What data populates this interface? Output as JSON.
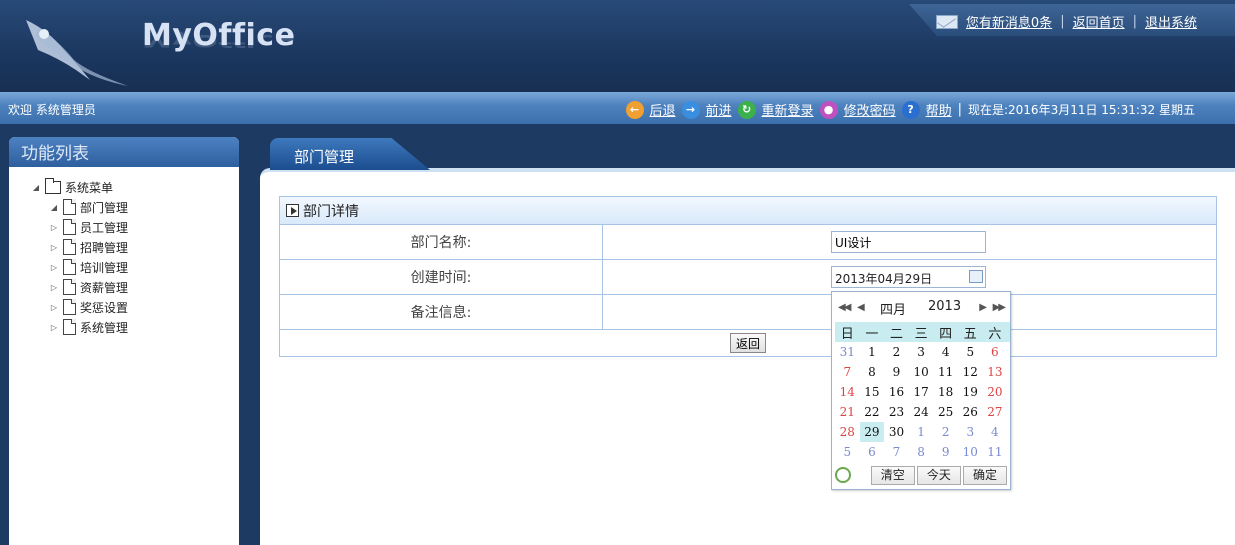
{
  "header": {
    "logo_text": "MyOffice",
    "logo_reflection": "MyOffice",
    "messages_link": "您有新消息0条",
    "home_link": "返回首页",
    "logout_link": "退出系统"
  },
  "statusbar": {
    "welcome": "欢迎 系统管理员",
    "back": "后退",
    "forward": "前进",
    "relogin": "重新登录",
    "change_password": "修改密码",
    "help": "帮助",
    "now": "现在是:2016年3月11日  15:31:32 星期五"
  },
  "sidebar": {
    "title": "功能列表",
    "root": "系统菜单",
    "items": [
      {
        "label": "部门管理"
      },
      {
        "label": "员工管理"
      },
      {
        "label": "招聘管理"
      },
      {
        "label": "培训管理"
      },
      {
        "label": "资薪管理"
      },
      {
        "label": "奖惩设置"
      },
      {
        "label": "系统管理"
      }
    ]
  },
  "main": {
    "tab": "部门管理",
    "section_title": "部门详情",
    "fields": {
      "name_label": "部门名称:",
      "name_value": "UI设计",
      "created_label": "创建时间:",
      "created_value": "2013年04月29日",
      "remarks_label": "备注信息:"
    },
    "back_button": "返回"
  },
  "calendar": {
    "month": "四月",
    "year": "2013",
    "weekdays": [
      "日",
      "一",
      "二",
      "三",
      "四",
      "五",
      "六"
    ],
    "weeks": [
      [
        "31",
        "1",
        "2",
        "3",
        "4",
        "5",
        "6"
      ],
      [
        "7",
        "8",
        "9",
        "10",
        "11",
        "12",
        "13"
      ],
      [
        "14",
        "15",
        "16",
        "17",
        "18",
        "19",
        "20"
      ],
      [
        "21",
        "22",
        "23",
        "24",
        "25",
        "26",
        "27"
      ],
      [
        "28",
        "29",
        "30",
        "1",
        "2",
        "3",
        "4"
      ],
      [
        "5",
        "6",
        "7",
        "8",
        "9",
        "10",
        "11"
      ]
    ],
    "selected_day": "29",
    "clear": "清空",
    "today": "今天",
    "ok": "确定"
  }
}
